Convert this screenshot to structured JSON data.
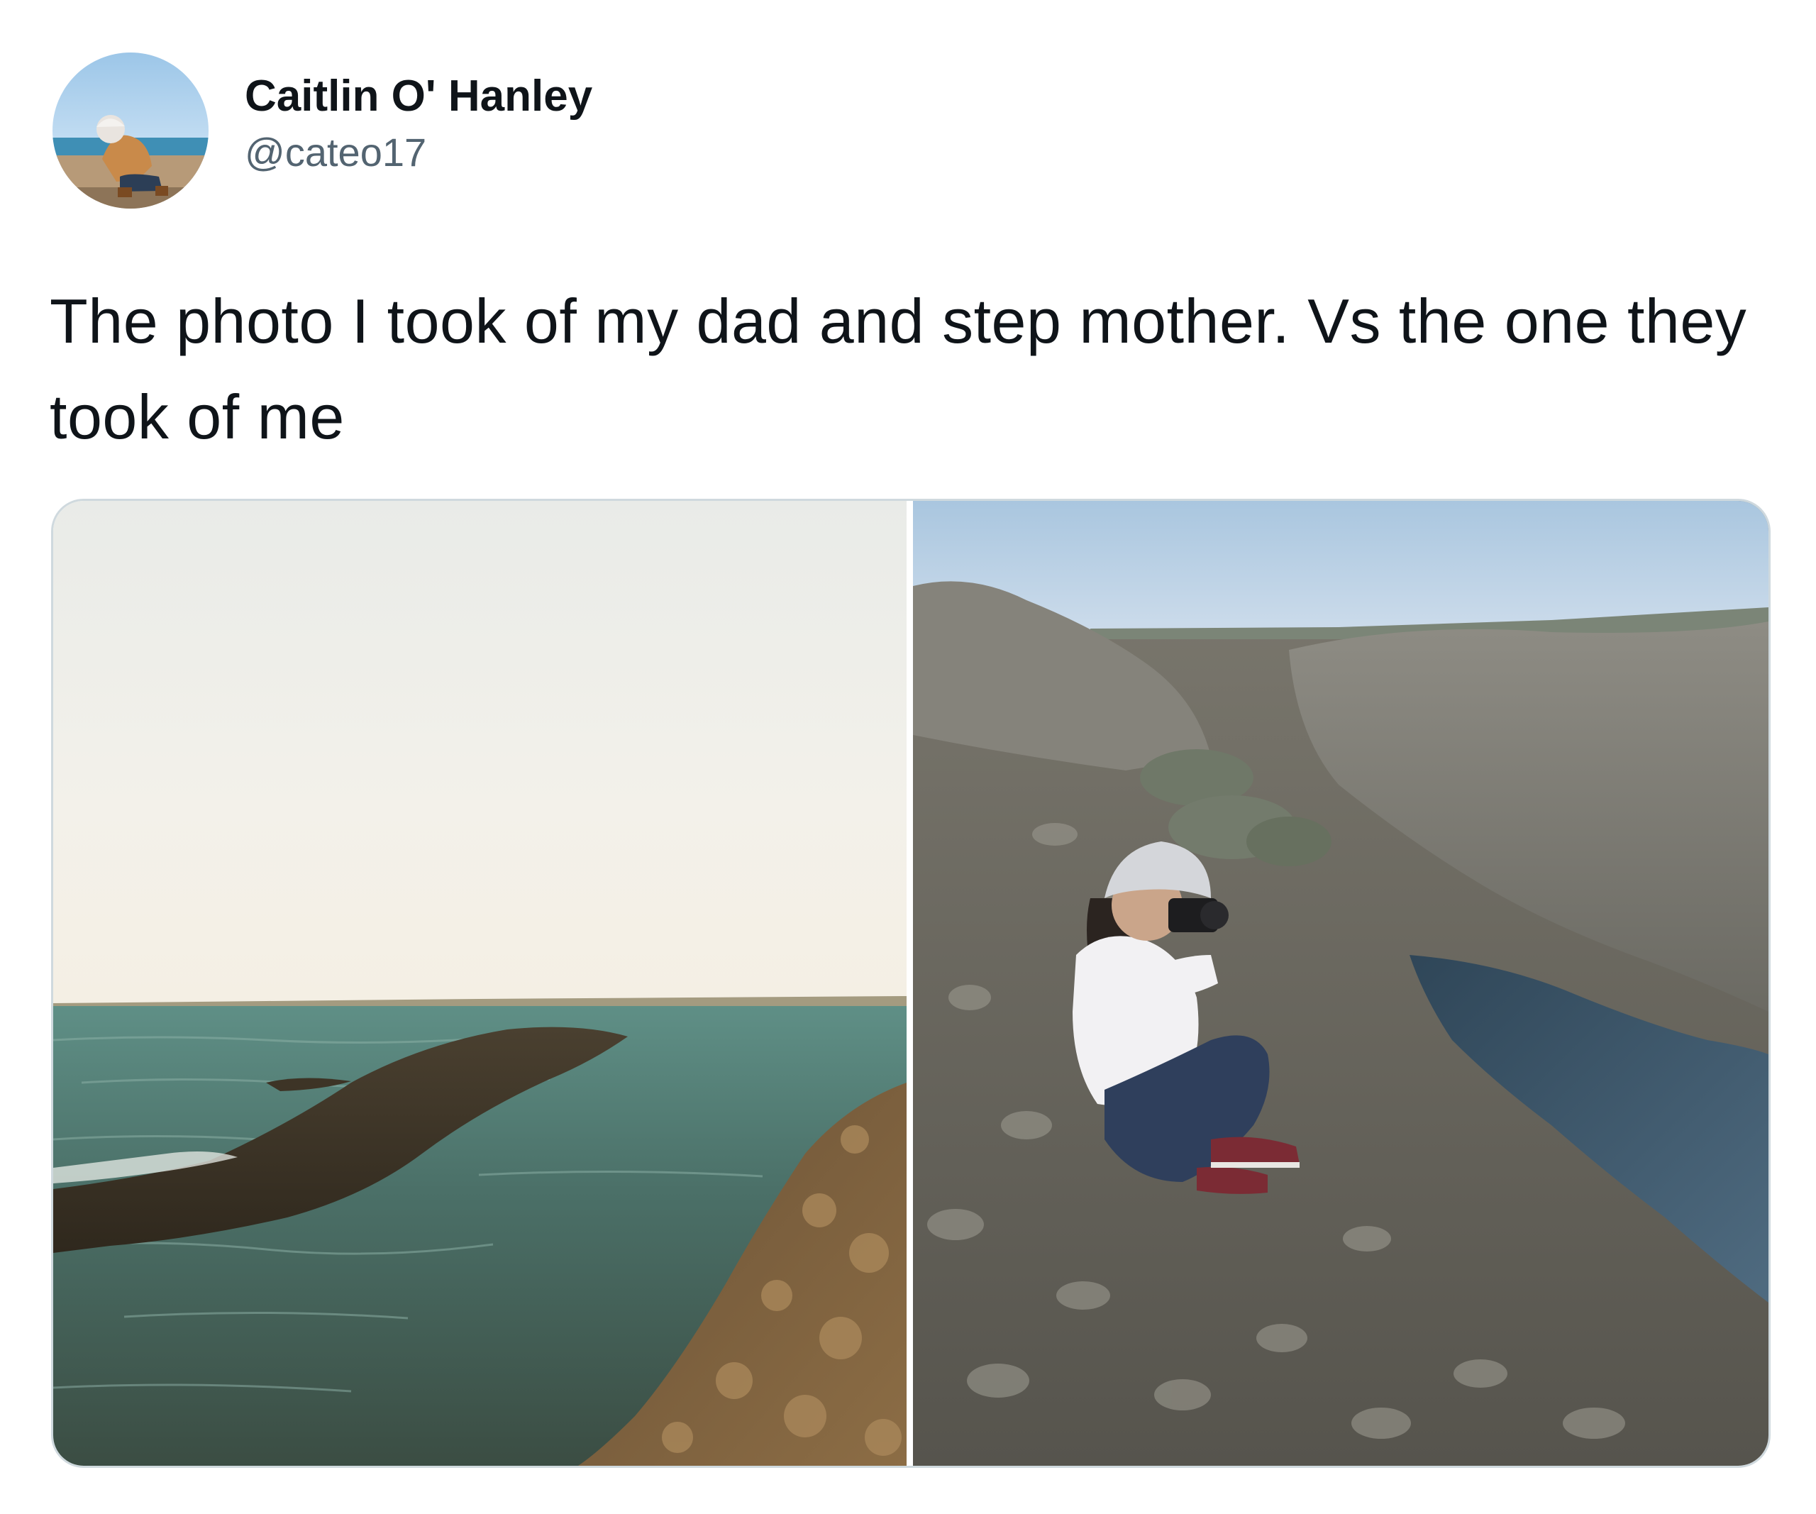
{
  "tweet": {
    "author": {
      "display_name": "Caitlin O' Hanley",
      "handle": "@cateo17",
      "avatar_icon": "profile-photo-avatar"
    },
    "text": "The photo I took of my dad and step mother. Vs the one they took of me",
    "media": [
      {
        "icon": "photo-sea-and-rocks"
      },
      {
        "icon": "photo-woman-with-camera-on-rocks"
      }
    ]
  },
  "colors": {
    "text_primary": "#0f1419",
    "text_secondary": "#536471",
    "media_border": "#cfd9de"
  }
}
